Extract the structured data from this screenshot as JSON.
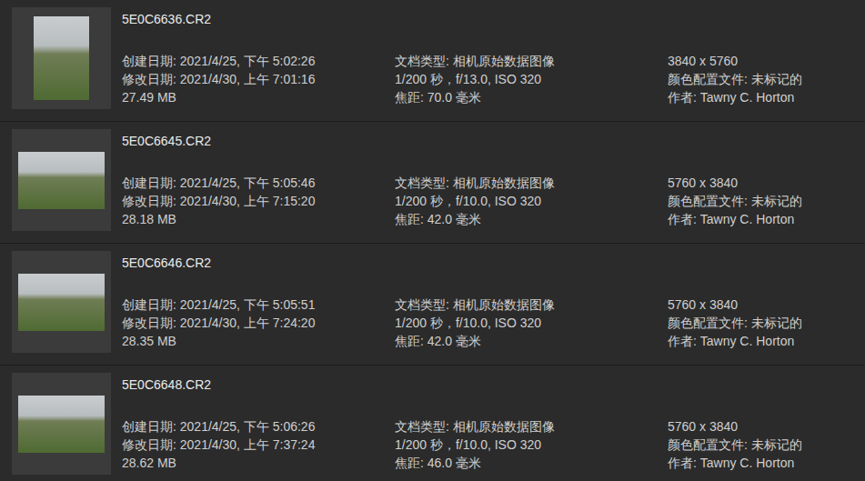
{
  "files": [
    {
      "name": "5E0C6636.CR2",
      "kind": "portrait",
      "created": "创建日期: 2021/4/25, 下午 5:02:26",
      "modified": "修改日期: 2021/4/30, 上午 7:01:16",
      "size": "27.49 MB",
      "type": "文档类型: 相机原始数据图像",
      "exposure": "1/200 秒，f/13.0, ISO 320",
      "focal": "焦距: 70.0 毫米",
      "dimensions": "3840 x 5760",
      "profile": "颜色配置文件: 未标记的",
      "author": "作者: Tawny C. Horton"
    },
    {
      "name": "5E0C6645.CR2",
      "kind": "landscape",
      "created": "创建日期: 2021/4/25, 下午 5:05:46",
      "modified": "修改日期: 2021/4/30, 上午 7:15:20",
      "size": "28.18 MB",
      "type": "文档类型: 相机原始数据图像",
      "exposure": "1/200 秒，f/10.0, ISO 320",
      "focal": "焦距: 42.0 毫米",
      "dimensions": "5760 x 3840",
      "profile": "颜色配置文件: 未标记的",
      "author": "作者: Tawny C. Horton"
    },
    {
      "name": "5E0C6646.CR2",
      "kind": "landscape",
      "created": "创建日期: 2021/4/25, 下午 5:05:51",
      "modified": "修改日期: 2021/4/30, 上午 7:24:20",
      "size": "28.35 MB",
      "type": "文档类型: 相机原始数据图像",
      "exposure": "1/200 秒，f/10.0, ISO 320",
      "focal": "焦距: 42.0 毫米",
      "dimensions": "5760 x 3840",
      "profile": "颜色配置文件: 未标记的",
      "author": "作者: Tawny C. Horton"
    },
    {
      "name": "5E0C6648.CR2",
      "kind": "landscape",
      "created": "创建日期: 2021/4/25, 下午 5:06:26",
      "modified": "修改日期: 2021/4/30, 上午 7:37:24",
      "size": "28.62 MB",
      "type": "文档类型: 相机原始数据图像",
      "exposure": "1/200 秒，f/10.0, ISO 320",
      "focal": "焦距: 46.0 毫米",
      "dimensions": "5760 x 3840",
      "profile": "颜色配置文件: 未标记的",
      "author": "作者: Tawny C. Horton"
    }
  ]
}
